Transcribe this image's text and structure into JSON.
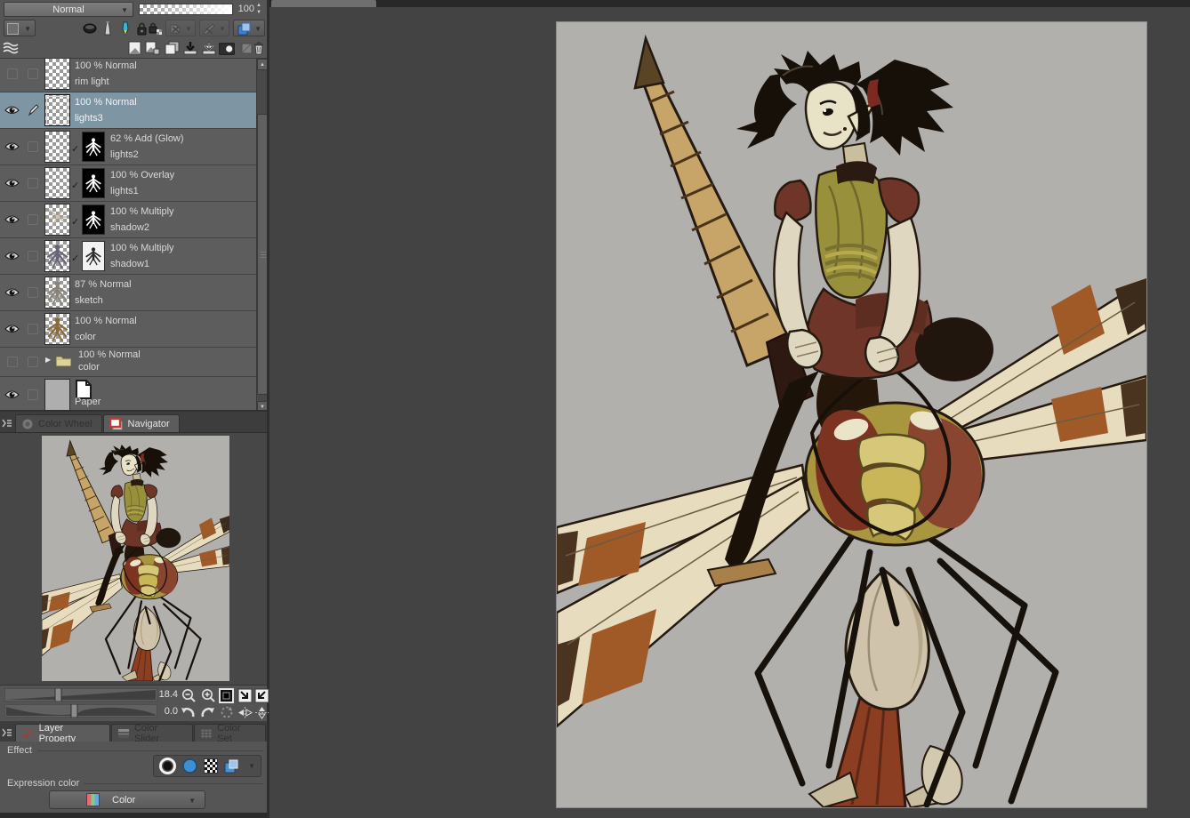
{
  "toolbar": {
    "blend_mode": "Normal",
    "opacity_value": "100"
  },
  "icons": {
    "check": "✓",
    "triangle_right": "▶",
    "chevron_down": "▼",
    "spinner_up": "▲",
    "spinner_down": "▼",
    "scroll_up": "▲",
    "scroll_down": "▼"
  },
  "layers": {
    "rows": [
      {
        "line1": "100 % Normal",
        "name": "rim light"
      },
      {
        "line1": "100 % Normal",
        "name": "lights3"
      },
      {
        "line1": "62 % Add (Glow)",
        "name": "lights2"
      },
      {
        "line1": "100 % Overlay",
        "name": "lights1"
      },
      {
        "line1": "100 % Multiply",
        "name": "shadow2"
      },
      {
        "line1": "100 % Multiply",
        "name": "shadow1"
      },
      {
        "line1": "87 % Normal",
        "name": "sketch"
      },
      {
        "line1": "100 % Normal",
        "name": "color"
      },
      {
        "line1": "100 % Normal",
        "name": "color"
      },
      {
        "name": "Paper"
      }
    ]
  },
  "panel_tabs": {
    "color_wheel": "Color Wheel",
    "navigator": "Navigator",
    "layer_property": "Layer Property",
    "color_slider": "Color Slider",
    "color_set": "Color Set"
  },
  "navigator": {
    "zoom_value": "18.4",
    "rotation_value": "0.0"
  },
  "layer_property": {
    "effect_label": "Effect",
    "expression_label": "Expression color",
    "color_mode": "Color"
  },
  "colors": {
    "panel_bg": "#565656",
    "selected_layer_bg": "#7e95a4",
    "canvas_surround": "#434343",
    "canvas_bg": "#b2b0ad",
    "accent_blue": "#5b9bd5",
    "expression_stripe_red": "#e66a7a",
    "expression_stripe_green": "#7ed07e",
    "expression_stripe_blue": "#6aa7e8"
  }
}
